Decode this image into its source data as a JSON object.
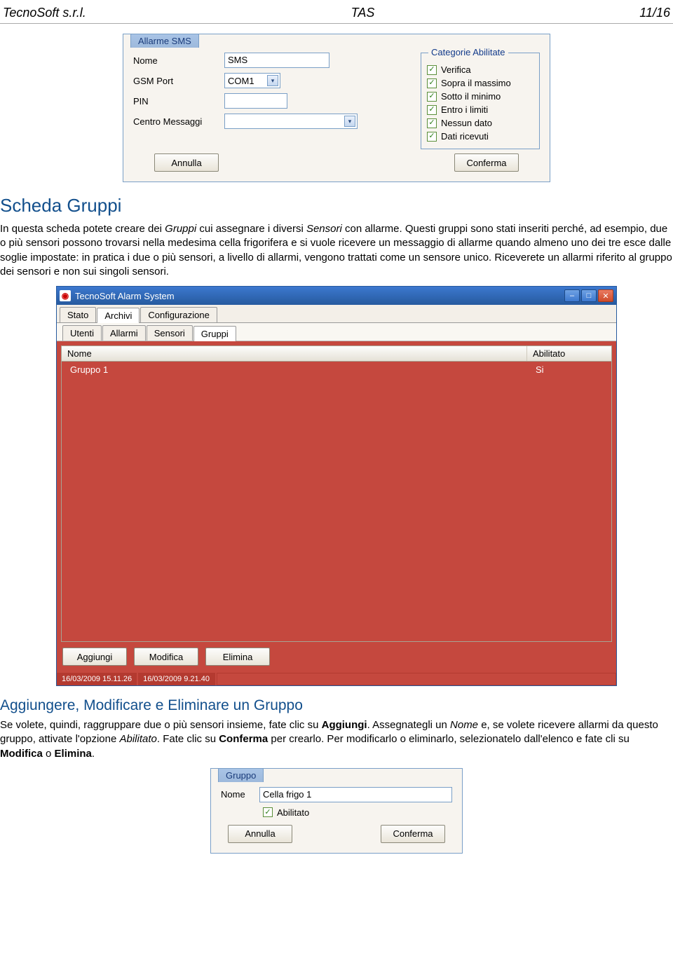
{
  "header": {
    "company": "TecnoSoft s.r.l.",
    "doc": "TAS",
    "page": "11/16"
  },
  "alarm_sms": {
    "title": "Allarme SMS",
    "labels": {
      "nome": "Nome",
      "gsm_port": "GSM Port",
      "pin": "PIN",
      "centro": "Centro Messaggi"
    },
    "values": {
      "nome": "SMS",
      "gsm_port": "COM1",
      "pin": "",
      "centro": ""
    },
    "categories_title": "Categorie Abilitate",
    "categories": [
      {
        "label": "Verifica",
        "checked": true
      },
      {
        "label": "Sopra il massimo",
        "checked": true
      },
      {
        "label": "Sotto il minimo",
        "checked": true
      },
      {
        "label": "Entro i limiti",
        "checked": true
      },
      {
        "label": "Nessun dato",
        "checked": true
      },
      {
        "label": "Dati ricevuti",
        "checked": true
      }
    ],
    "cancel": "Annulla",
    "confirm": "Conferma"
  },
  "section1": {
    "title": "Scheda Gruppi",
    "p1a": "In questa scheda potete creare dei ",
    "p1b": "Gruppi",
    "p1c": " cui assegnare i diversi ",
    "p1d": "Sensori",
    "p1e": " con allarme. Questi gruppi sono stati inseriti perché, ad esempio, due o più sensori possono trovarsi nella medesima cella frigorifera e si vuole ricevere un messaggio di allarme quando almeno uno dei tre esce dalle soglie impostate: in pratica i due o più sensori, a livello di allarmi, vengono trattati come un sensore unico. Riceverete un allarmi riferito al gruppo dei sensori e non sui singoli sensori."
  },
  "app": {
    "title": "TecnoSoft Alarm System",
    "main_tabs": [
      "Stato",
      "Archivi",
      "Configurazione"
    ],
    "main_active": 1,
    "sub_tabs": [
      "Utenti",
      "Allarmi",
      "Sensori",
      "Gruppi"
    ],
    "sub_active": 3,
    "columns": {
      "name": "Nome",
      "enabled": "Abilitato"
    },
    "rows": [
      {
        "name": "Gruppo 1",
        "enabled": "Si"
      }
    ],
    "buttons": {
      "add": "Aggiungi",
      "edit": "Modifica",
      "del": "Elimina"
    },
    "status": [
      "16/03/2009 15.11.26",
      "16/03/2009 9.21.40"
    ]
  },
  "section2": {
    "title": "Aggiungere, Modificare e Eliminare un Gruppo",
    "t1": "Se volete, quindi, raggruppare due o più sensori insieme, fate clic su ",
    "t2": "Aggiungi",
    "t3": ". Assegnategli un ",
    "t4": "Nome",
    "t5": " e, se volete ricevere allarmi da questo gruppo, attivate l'opzione ",
    "t6": "Abilitato",
    "t7": ". Fate clic su ",
    "t8": "Conferma",
    "t9": " per crearlo. Per modificarlo o eliminarlo, selezionatelo dall'elenco e fate cli su ",
    "t10": "Modifica",
    "t11": " o ",
    "t12": "Elimina",
    "t13": "."
  },
  "gruppo_dialog": {
    "title": "Gruppo",
    "nome_label": "Nome",
    "nome_value": "Cella frigo 1",
    "abilitato_label": "Abilitato",
    "cancel": "Annulla",
    "confirm": "Conferma"
  }
}
